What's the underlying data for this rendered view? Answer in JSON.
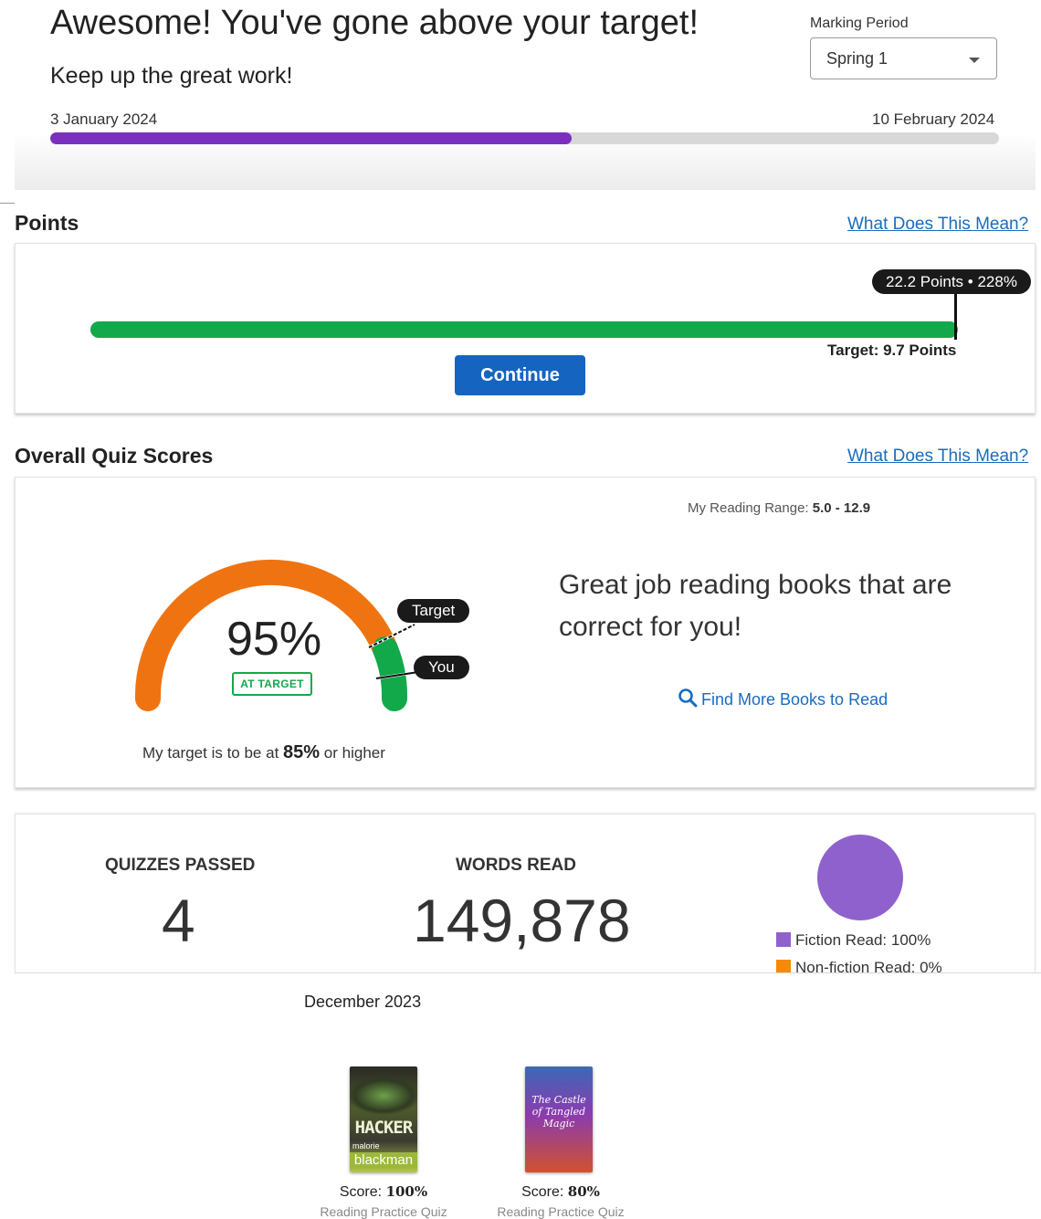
{
  "header": {
    "headline": "Awesome! You've gone above your target!",
    "subline": "Keep up the great work!",
    "marking_period_label": "Marking Period",
    "marking_period_value": "Spring 1",
    "start_date": "3 January 2024",
    "end_date": "10 February 2024",
    "period_progress": 0.55
  },
  "points": {
    "title": "Points",
    "help_link": "What Does This Mean?",
    "pill": "22.2 Points • 228%",
    "target_label": "Target: 9.7 Points",
    "continue_label": "Continue"
  },
  "quiz": {
    "title": "Overall Quiz Scores",
    "help_link": "What Does This Mean?",
    "reading_range_label": "My Reading Range:",
    "reading_range_value": "5.0 - 12.9",
    "percent": "95%",
    "percent_value": 95,
    "target_value": 85,
    "status_badge": "AT TARGET",
    "target_tag": "Target",
    "you_tag": "You",
    "target_sentence_pre": "My target is to be at",
    "target_sentence_value": "85%",
    "target_sentence_post": "or higher",
    "message": "Great job reading books that are correct for you!",
    "find_books": "Find More Books to Read"
  },
  "stats": {
    "quizzes_passed_label": "QUIZZES PASSED",
    "quizzes_passed_value": "4",
    "words_read_label": "WORDS READ",
    "words_read_value": "149,878",
    "fiction_label": "Fiction Read: 100%",
    "nonfiction_label": "Non-fiction Read: 0%",
    "fiction_fraction": 1.0
  },
  "colors": {
    "period_bar": "#7b2fbe",
    "points_bar": "#12a94a",
    "gauge_orange": "#ef7411",
    "gauge_green": "#12a94a",
    "fiction": "#8f61cc",
    "nonfiction": "#f58a07",
    "link": "#1a6cbf",
    "button": "#1565c0"
  },
  "december": {
    "month": "December 2023",
    "books": [
      {
        "cover_title": "HACKER",
        "cover_author_first": "malorie",
        "cover_author_last": "blackman",
        "score_label": "Score:",
        "score_value": "100%",
        "type": "Reading Practice Quiz"
      },
      {
        "cover_title": "The Castle of Tangled Magic",
        "score_label": "Score:",
        "score_value": "80%",
        "type": "Reading Practice Quiz"
      }
    ]
  },
  "icons": {
    "search": "search-icon",
    "caret": "chevron-down-icon"
  }
}
